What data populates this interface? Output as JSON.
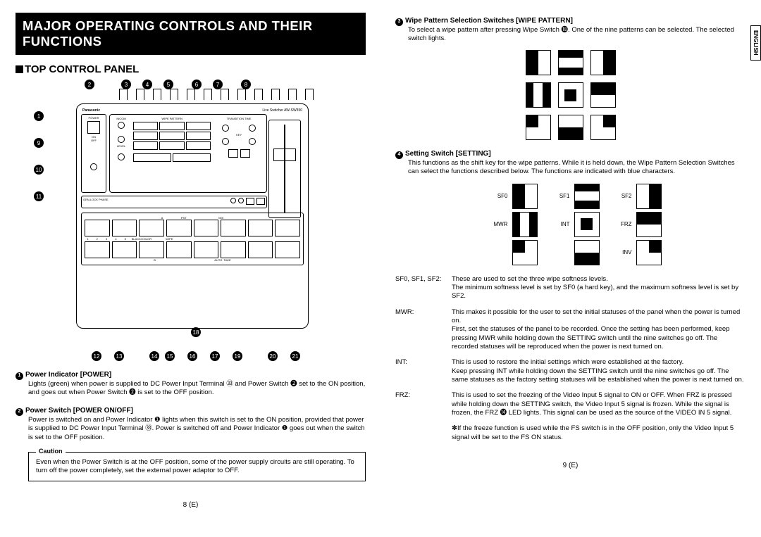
{
  "language_tab": "ENGLISH",
  "banner": "MAJOR OPERATING CONTROLS AND THEIR FUNCTIONS",
  "section_title": "TOP CONTROL PANEL",
  "panel_brand": "Panasonic",
  "panel_model": "Live Switcher  AW-SW350",
  "top_callouts": [
    "2",
    "3",
    "4",
    "5",
    "6",
    "7",
    "8"
  ],
  "left_callouts": [
    "1",
    "9",
    "10",
    "11"
  ],
  "bottom_callouts": [
    "12",
    "13",
    "14",
    "15",
    "16",
    "17",
    "18",
    "19",
    "20",
    "21"
  ],
  "items_left": [
    {
      "num": "1",
      "title": "Power Indicator [POWER]",
      "body": "Lights (green) when power is supplied to DC Power Input Terminal ㉝ and Power Switch ❷ set to the ON position, and goes out when Power Switch ❷ is set to the OFF position."
    },
    {
      "num": "2",
      "title": "Power Switch [POWER ON/OFF]",
      "body": "Power is switched on and Power Indicator ❶ lights when this switch is set to the ON position, provided that power is supplied to DC Power Input Terminal ㉝. Power is switched off and Power Indicator ❶ goes out when the switch is set to the OFF position."
    }
  ],
  "caution_label": "Caution",
  "caution_body": "Even when the Power Switch is at the OFF position, some of the power supply circuits are still operating. To turn off the power completely, set the external power adaptor to OFF.",
  "page_left": "8 (E)",
  "items_right_top": {
    "num": "3",
    "title": "Wipe Pattern Selection Switches [WIPE PATTERN]",
    "body": "To select a wipe pattern after pressing Wipe Switch ⓲. One of the nine patterns can be selected. The selected switch lights."
  },
  "setting_item": {
    "num": "4",
    "title": "Setting Switch [SETTING]",
    "body": "This functions as the shift key for the wipe patterns. While it is held down, the Wipe Pattern Selection Switches can select the functions described below. The functions are indicated with blue characters."
  },
  "labeled_names": [
    "SF0",
    "SF1",
    "SF2",
    "MWR",
    "INT",
    "FRZ",
    "",
    "",
    "INV"
  ],
  "desc": [
    {
      "k": "SF0, SF1, SF2:",
      "v": "These are used to set the three wipe softness levels.\nThe minimum softness level is set by SF0 (a hard key), and the maximum softness level is set by SF2."
    },
    {
      "k": "MWR:",
      "v": "This makes it possible for the user to set the initial statuses of the panel when the power is turned on.\nFirst, set the statuses of the panel to be recorded. Once the setting has been performed, keep pressing MWR while holding down the SETTING switch until the nine switches go off. The recorded statuses will be reproduced when the power is next turned on."
    },
    {
      "k": "INT:",
      "v": "This is used to restore the initial settings which were established at the factory.\nKeep pressing INT while holding down the SETTING switch until the nine switches go off. The same statuses as the factory setting statuses will be established when the power is next turned on."
    },
    {
      "k": "FRZ:",
      "v": "This is used to set the freezing of the Video Input 5 signal to ON or OFF. When FRZ is pressed while holding down the SETTING switch, the Video Input 5 signal is frozen. While the signal is frozen, the FRZ ⓮ LED lights. This signal can be used as the source of the VIDEO IN 5 signal."
    }
  ],
  "note": "✽If the freeze function is used while the FS switch is in the OFF position, only the Video Input 5 signal will be set to the FS ON status.",
  "page_right": "9 (E)"
}
